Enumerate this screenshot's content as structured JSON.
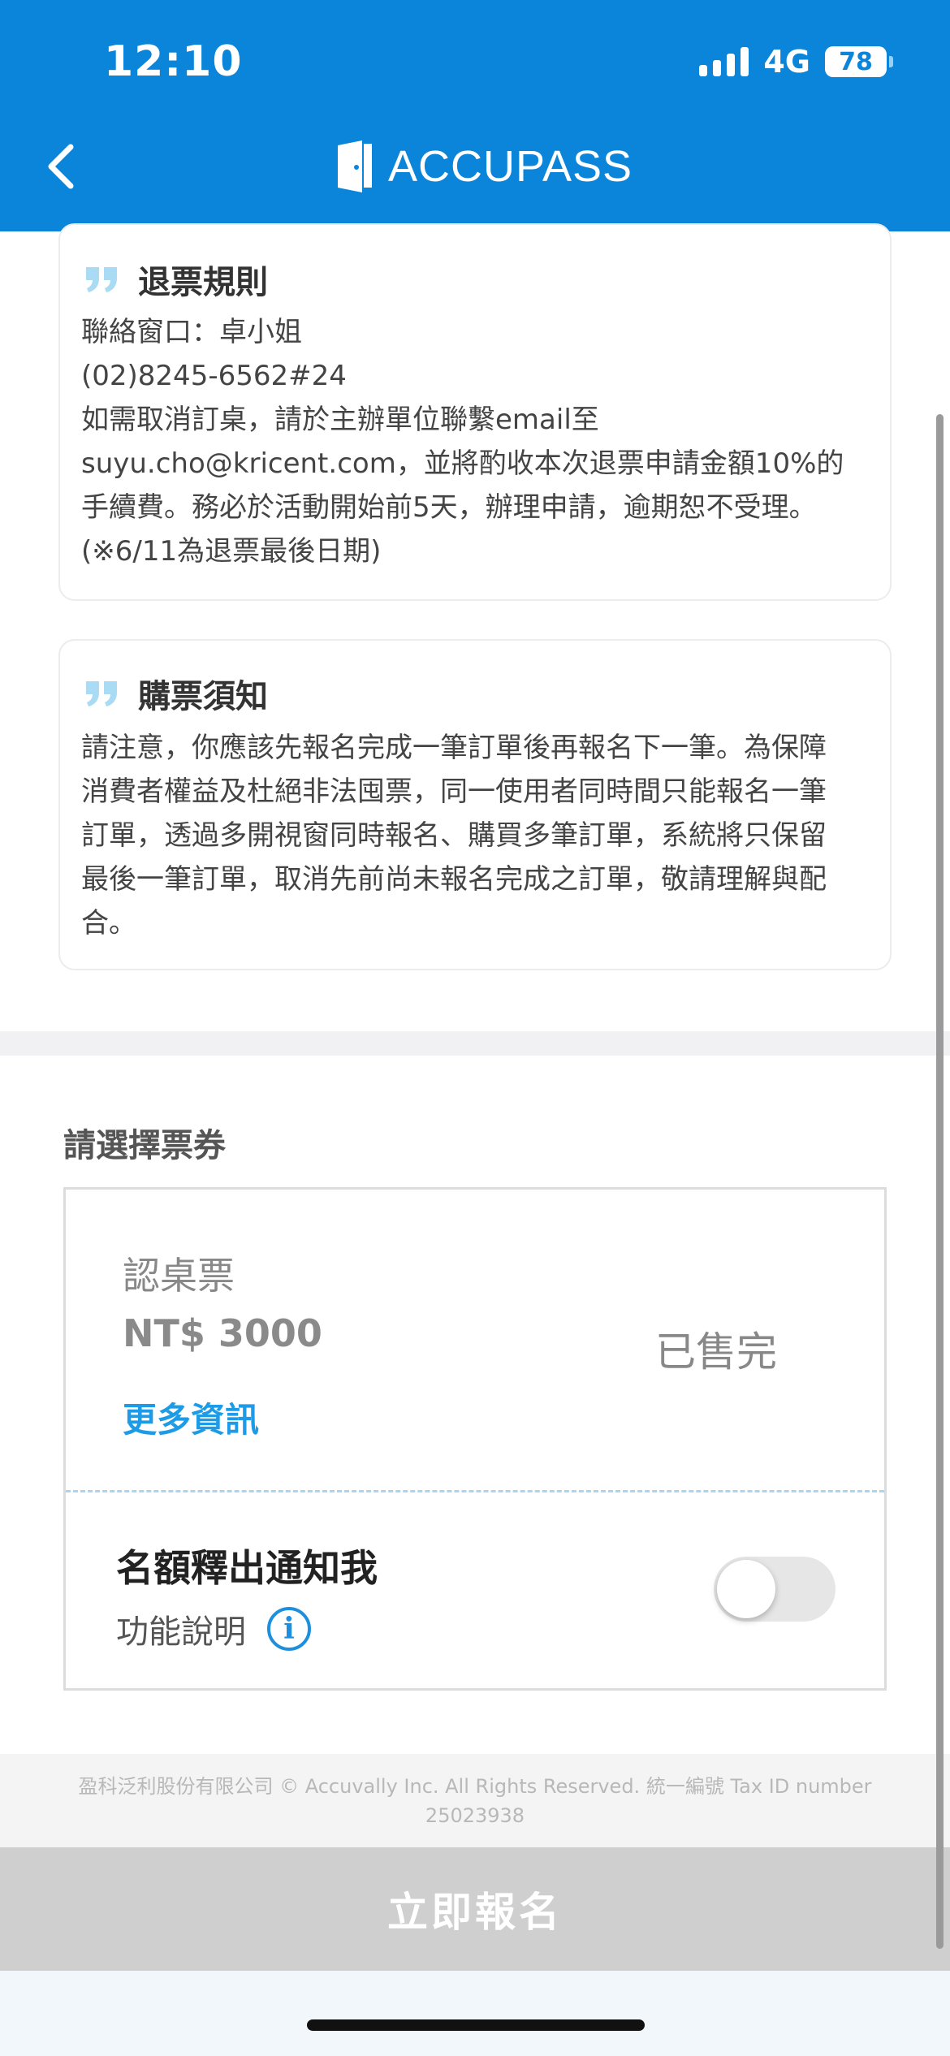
{
  "status_bar": {
    "time": "12:10",
    "network": "4G",
    "battery": "78"
  },
  "header": {
    "back_icon": "chevron-left-icon",
    "brand": "ACCUPASS",
    "logo_icon": "door-logo-icon"
  },
  "refund_card": {
    "title": "退票規則",
    "lines": [
      "聯絡窗口：卓小姐",
      "(02)8245-6562#24",
      "如需取消訂桌，請於主辦單位聯繫email至",
      "suyu.cho@kricent.com，並將酌收本次退票申請金額10%的",
      "手續費。務必於活動開始前5天，辦理申請，逾期恕不受理。",
      "(※6/11為退票最後日期)"
    ]
  },
  "notice_card": {
    "title": "購票須知",
    "lines": [
      "請注意，你應該先報名完成一筆訂單後再報名下一筆。為保障",
      "消費者權益及杜絕非法囤票，同一使用者同時間只能報名一筆",
      "訂單，透過多開視窗同時報名、購買多筆訂單，系統將只保留",
      "最後一筆訂單，取消先前尚未報名完成之訂單，敬請理解與配",
      "合。"
    ]
  },
  "ticket_section": {
    "title": "請選擇票券",
    "ticket": {
      "name": "認桌票",
      "price": "NT$ 3000",
      "more_info": "更多資訊",
      "status": "已售完"
    },
    "notify": {
      "title": "名額釋出通知我",
      "description": "功能說明",
      "info_icon": "info-icon",
      "toggle_on": false
    }
  },
  "footer": {
    "line1": "盈科泛利股份有限公司 © Accuvally Inc. All Rights Reserved. 統一編號 Tax ID number",
    "line2": "25023938"
  },
  "cta": {
    "label": "立即報名"
  },
  "colors": {
    "brand_blue": "#0a85d9",
    "link_blue": "#1e9be6",
    "quote_blue": "#a9dcf4",
    "disabled_gray": "#cfcfcf"
  }
}
